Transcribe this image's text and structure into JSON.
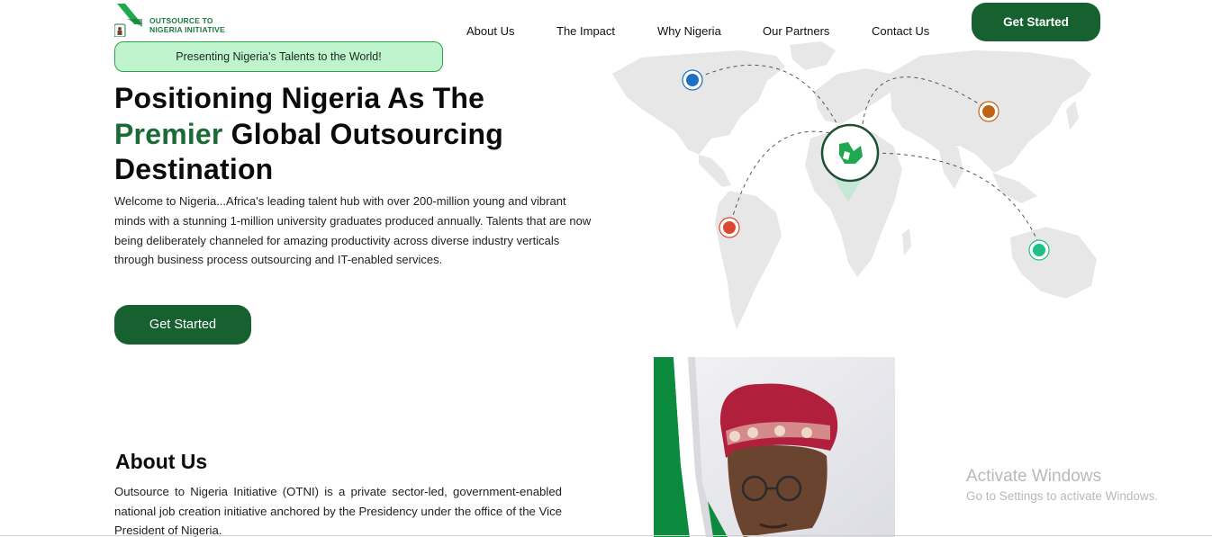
{
  "header": {
    "logo": {
      "line1": "OUTSOURCE TO",
      "line2": "NIGERIA INITIATIVE"
    },
    "nav": [
      "About Us",
      "The Impact",
      "Why Nigeria",
      "Our Partners",
      "Contact Us"
    ],
    "cta_label": "Get Started"
  },
  "hero": {
    "tagline": "Presenting Nigeria's Talents to the World!",
    "headline_part1": "Positioning Nigeria As The",
    "headline_accent": "Premier",
    "headline_part2": " Global Outsourcing Destination",
    "body": "Welcome to Nigeria...Africa's leading talent hub with over 200-million young and vibrant minds with a stunning 1-million university graduates produced annually. Talents that are now being deliberately channeled for amazing productivity across diverse industry verticals through business process outsourcing and IT-enabled services.",
    "cta_label": "Get Started"
  },
  "map": {
    "markers": [
      {
        "name": "north-america",
        "color": "#1f6fc4"
      },
      {
        "name": "asia",
        "color": "#c06414"
      },
      {
        "name": "south-america",
        "color": "#d9482f"
      },
      {
        "name": "australia",
        "color": "#1fbf86"
      }
    ],
    "hub_color": "#1a6b35"
  },
  "about": {
    "title": "About Us",
    "body": "Outsource to Nigeria Initiative (OTNI) is a private sector-led, government-enabled national job creation initiative anchored by the Presidency under the office of the Vice President of Nigeria."
  },
  "watermark": {
    "title": "Activate Windows",
    "subtitle": "Go to Settings to activate Windows."
  },
  "colors": {
    "brand_green": "#17602f",
    "pill_bg": "#bff4cc",
    "accent_text": "#1a6b35"
  }
}
